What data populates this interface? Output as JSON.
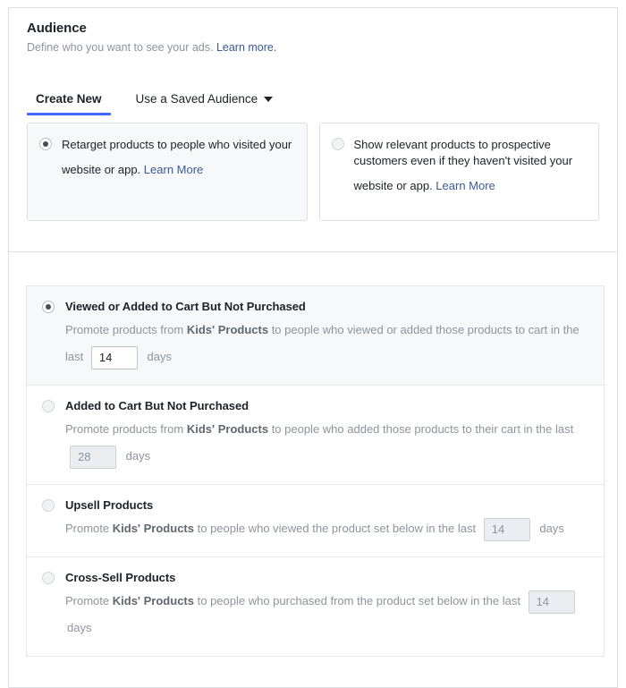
{
  "header": {
    "title": "Audience",
    "subtitle": "Define who you want to see your ads.",
    "learn_more": "Learn more."
  },
  "tabs": [
    {
      "label": "Create New",
      "active": true
    },
    {
      "label": "Use a Saved Audience",
      "active": false,
      "has_caret": true
    }
  ],
  "choice_cards": [
    {
      "text": "Retarget products to people who visited your website or app.",
      "learn_more": "Learn More",
      "selected": true
    },
    {
      "text": "Show relevant products to prospective customers even if they haven't visited your website or app.",
      "learn_more": "Learn More",
      "selected": false
    }
  ],
  "options": [
    {
      "title": "Viewed or Added to Cart But Not Purchased",
      "desc_before": "Promote products from",
      "product_set": "Kids' Products",
      "desc_middle": "to people who viewed or added those products to cart in the last",
      "days_value": "14",
      "days_label": "days",
      "selected": true,
      "input_enabled": true
    },
    {
      "title": "Added to Cart But Not Purchased",
      "desc_before": "Promote products from",
      "product_set": "Kids' Products",
      "desc_middle": "to people who added those products to their cart in the last",
      "days_value": "28",
      "days_label": "days",
      "selected": false,
      "input_enabled": false
    },
    {
      "title": "Upsell Products",
      "desc_before": "Promote",
      "product_set": "Kids' Products",
      "desc_middle": "to people who viewed the product set below in the last",
      "days_value": "14",
      "days_label": "days",
      "selected": false,
      "input_enabled": false
    },
    {
      "title": "Cross-Sell Products",
      "desc_before": "Promote",
      "product_set": "Kids' Products",
      "desc_middle": "to people who purchased from the product set below in the last",
      "days_value": "14",
      "days_label": "days",
      "selected": false,
      "input_enabled": false
    }
  ],
  "colors": {
    "accent_blue": "#4267ff",
    "link_blue": "#385898",
    "panel_border": "#dddfe2",
    "row_active_bg": "#f7f8fa"
  }
}
